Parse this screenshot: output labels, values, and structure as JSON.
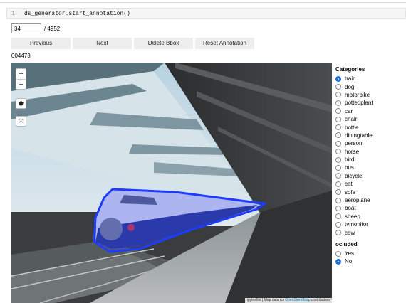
{
  "cell": {
    "line_number": "1",
    "code": "ds_generator.start_annotation()"
  },
  "navigator": {
    "index_value": "34",
    "total": "/ 4952"
  },
  "buttons": {
    "previous": "Previous",
    "next": "Next",
    "delete_bbox": "Delete Bbox",
    "reset_annotation": "Reset Annotation"
  },
  "image": {
    "id": "004473"
  },
  "map": {
    "zoom_in": "+",
    "zoom_out": "−",
    "polygon_tool": "⬟",
    "fullscreen": "⤧",
    "attribution_prefix": "ipyleaflet | Map data (c)",
    "attribution_link": "OpenStreetMap",
    "attribution_suffix": "contributors",
    "annotation_color": "#1e3cff"
  },
  "categories": {
    "heading": "Categories",
    "selected": "train",
    "options": [
      "train",
      "dog",
      "motorbike",
      "pottedplant",
      "car",
      "chair",
      "bottle",
      "diningtable",
      "person",
      "horse",
      "bird",
      "bus",
      "bicycle",
      "cat",
      "sofa",
      "aeroplane",
      "boat",
      "sheep",
      "tvmonitor",
      "cow"
    ]
  },
  "occluded": {
    "heading": "ocluded",
    "selected": "No",
    "options": [
      "Yes",
      "No"
    ]
  }
}
